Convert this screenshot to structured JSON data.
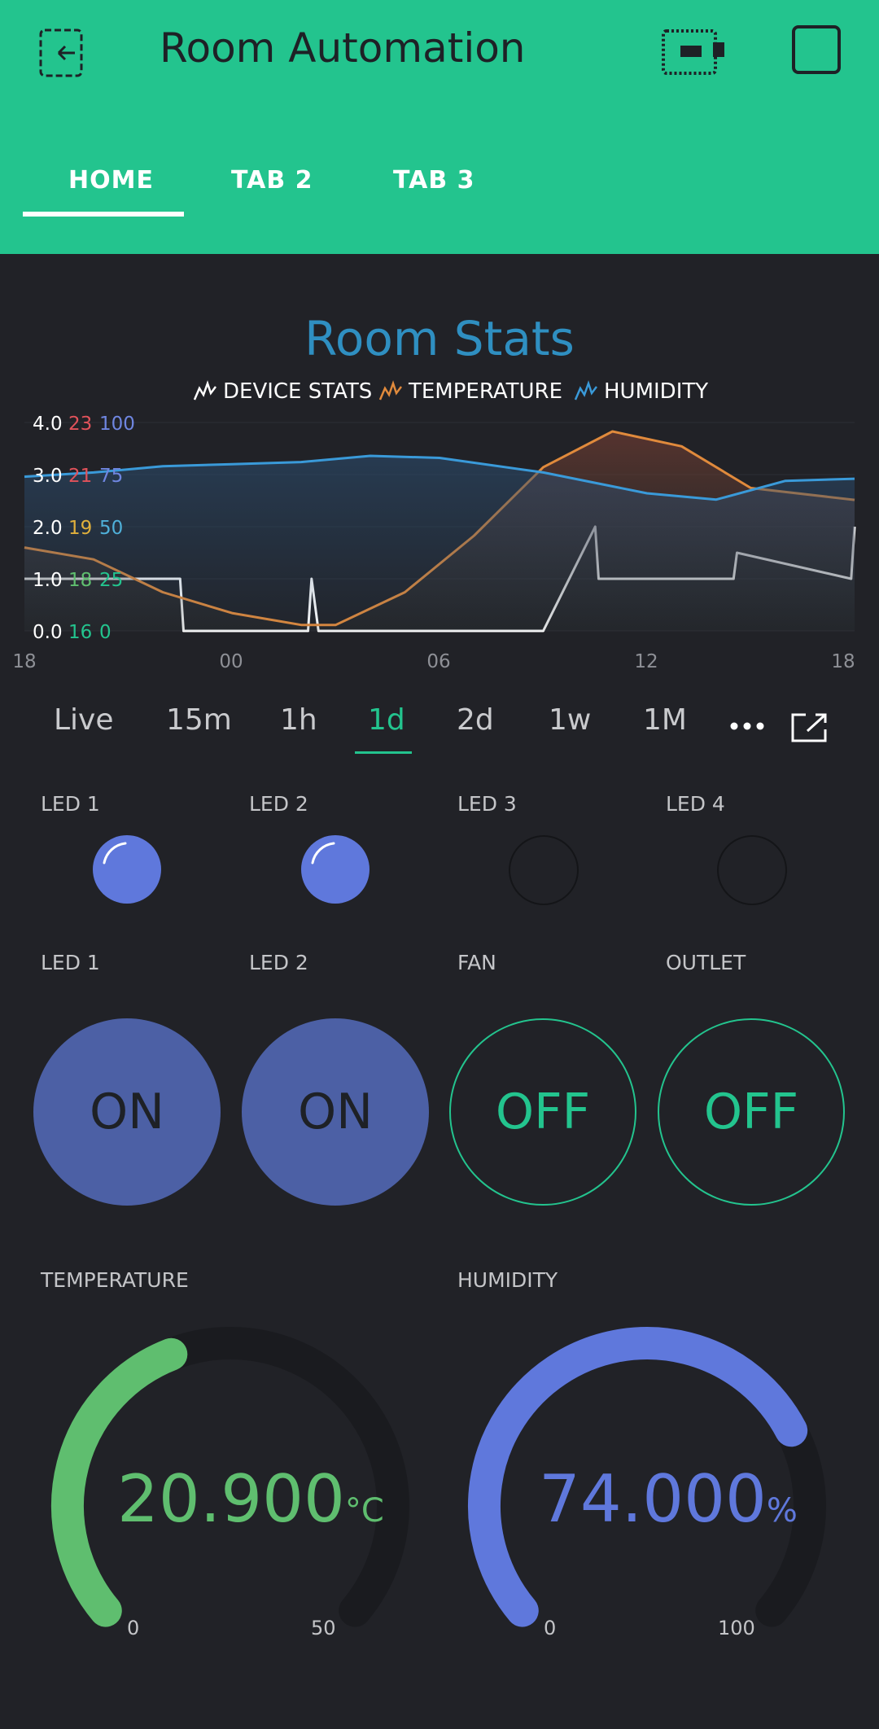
{
  "header": {
    "title": "Room Automation",
    "tabs": [
      {
        "label": "HOME",
        "active": true
      },
      {
        "label": "TAB 2",
        "active": false
      },
      {
        "label": "TAB 3",
        "active": false
      }
    ],
    "icons": [
      "back-icon",
      "device-status-icon",
      "stop-icon"
    ]
  },
  "chart": {
    "title": "Room Stats",
    "legend": [
      "DEVICE STATS",
      "TEMPERATURE",
      "HUMIDITY"
    ],
    "y_ticks_device": [
      "4.0",
      "3.0",
      "2.0",
      "1.0",
      "0.0"
    ],
    "y_ticks_temperature": [
      "23",
      "21",
      "19",
      "18",
      "16"
    ],
    "y_ticks_humidity": [
      "100",
      "75",
      "50",
      "25",
      "0"
    ],
    "x_ticks": [
      "18",
      "00",
      "06",
      "12",
      "18"
    ]
  },
  "chart_data": {
    "type": "line",
    "title": "Room Stats",
    "x": [
      "18",
      "00",
      "06",
      "12",
      "18"
    ],
    "series": [
      {
        "name": "DEVICE STATS",
        "color": "#ffffff",
        "axis": [
          0,
          4
        ],
        "values_hours": [
          [
            0,
            1
          ],
          [
            4.5,
            1
          ],
          [
            4.6,
            0
          ],
          [
            8.2,
            0
          ],
          [
            8.3,
            1
          ],
          [
            8.5,
            0
          ],
          [
            9,
            0
          ],
          [
            15,
            0
          ],
          [
            16.5,
            2
          ],
          [
            16.6,
            1
          ],
          [
            20.5,
            1
          ],
          [
            20.6,
            1.5
          ],
          [
            23.9,
            1
          ],
          [
            24,
            2
          ]
        ]
      },
      {
        "name": "TEMPERATURE",
        "color": "#e08a3c",
        "axis": [
          16,
          23
        ],
        "values_hours": [
          [
            0,
            18.8
          ],
          [
            2,
            18.4
          ],
          [
            4,
            17.3
          ],
          [
            6,
            16.6
          ],
          [
            8,
            16.2
          ],
          [
            9,
            16.2
          ],
          [
            11,
            17.3
          ],
          [
            13,
            19.2
          ],
          [
            15,
            21.5
          ],
          [
            17,
            22.7
          ],
          [
            19,
            22.2
          ],
          [
            21,
            20.8
          ],
          [
            24,
            20.4
          ]
        ]
      },
      {
        "name": "HUMIDITY",
        "color": "#3a9ad9",
        "axis": [
          0,
          100
        ],
        "values_hours": [
          [
            0,
            74
          ],
          [
            2,
            76
          ],
          [
            4,
            79
          ],
          [
            6,
            80
          ],
          [
            8,
            81
          ],
          [
            10,
            84
          ],
          [
            12,
            83
          ],
          [
            15,
            76
          ],
          [
            18,
            66
          ],
          [
            20,
            63
          ],
          [
            22,
            72
          ],
          [
            24,
            73
          ]
        ]
      }
    ],
    "time_ranges": [
      "Live",
      "15m",
      "1h",
      "1d",
      "2d",
      "1w",
      "1M"
    ],
    "selected_range": "1d"
  },
  "time_ranges": [
    "Live",
    "15m",
    "1h",
    "1d",
    "2d",
    "1w",
    "1M"
  ],
  "leds": [
    {
      "label": "LED 1",
      "on": true
    },
    {
      "label": "LED 2",
      "on": true
    },
    {
      "label": "LED 3",
      "on": false
    },
    {
      "label": "LED 4",
      "on": false
    }
  ],
  "buttons": [
    {
      "label": "LED 1",
      "state": "ON"
    },
    {
      "label": "LED 2",
      "state": "ON"
    },
    {
      "label": "FAN",
      "state": "OFF"
    },
    {
      "label": "OUTLET",
      "state": "OFF"
    }
  ],
  "gauges": [
    {
      "label": "TEMPERATURE",
      "value": "20.900",
      "unit": "°C",
      "min": "0",
      "max": "50",
      "fraction": 0.418,
      "color": "#5fbe6f"
    },
    {
      "label": "HUMIDITY",
      "value": "74.000",
      "unit": "%",
      "min": "0",
      "max": "100",
      "fraction": 0.74,
      "color": "#5f78dc"
    }
  ],
  "colors": {
    "accent": "#23c48e",
    "background": "#212227",
    "on": "#5f78dc"
  }
}
